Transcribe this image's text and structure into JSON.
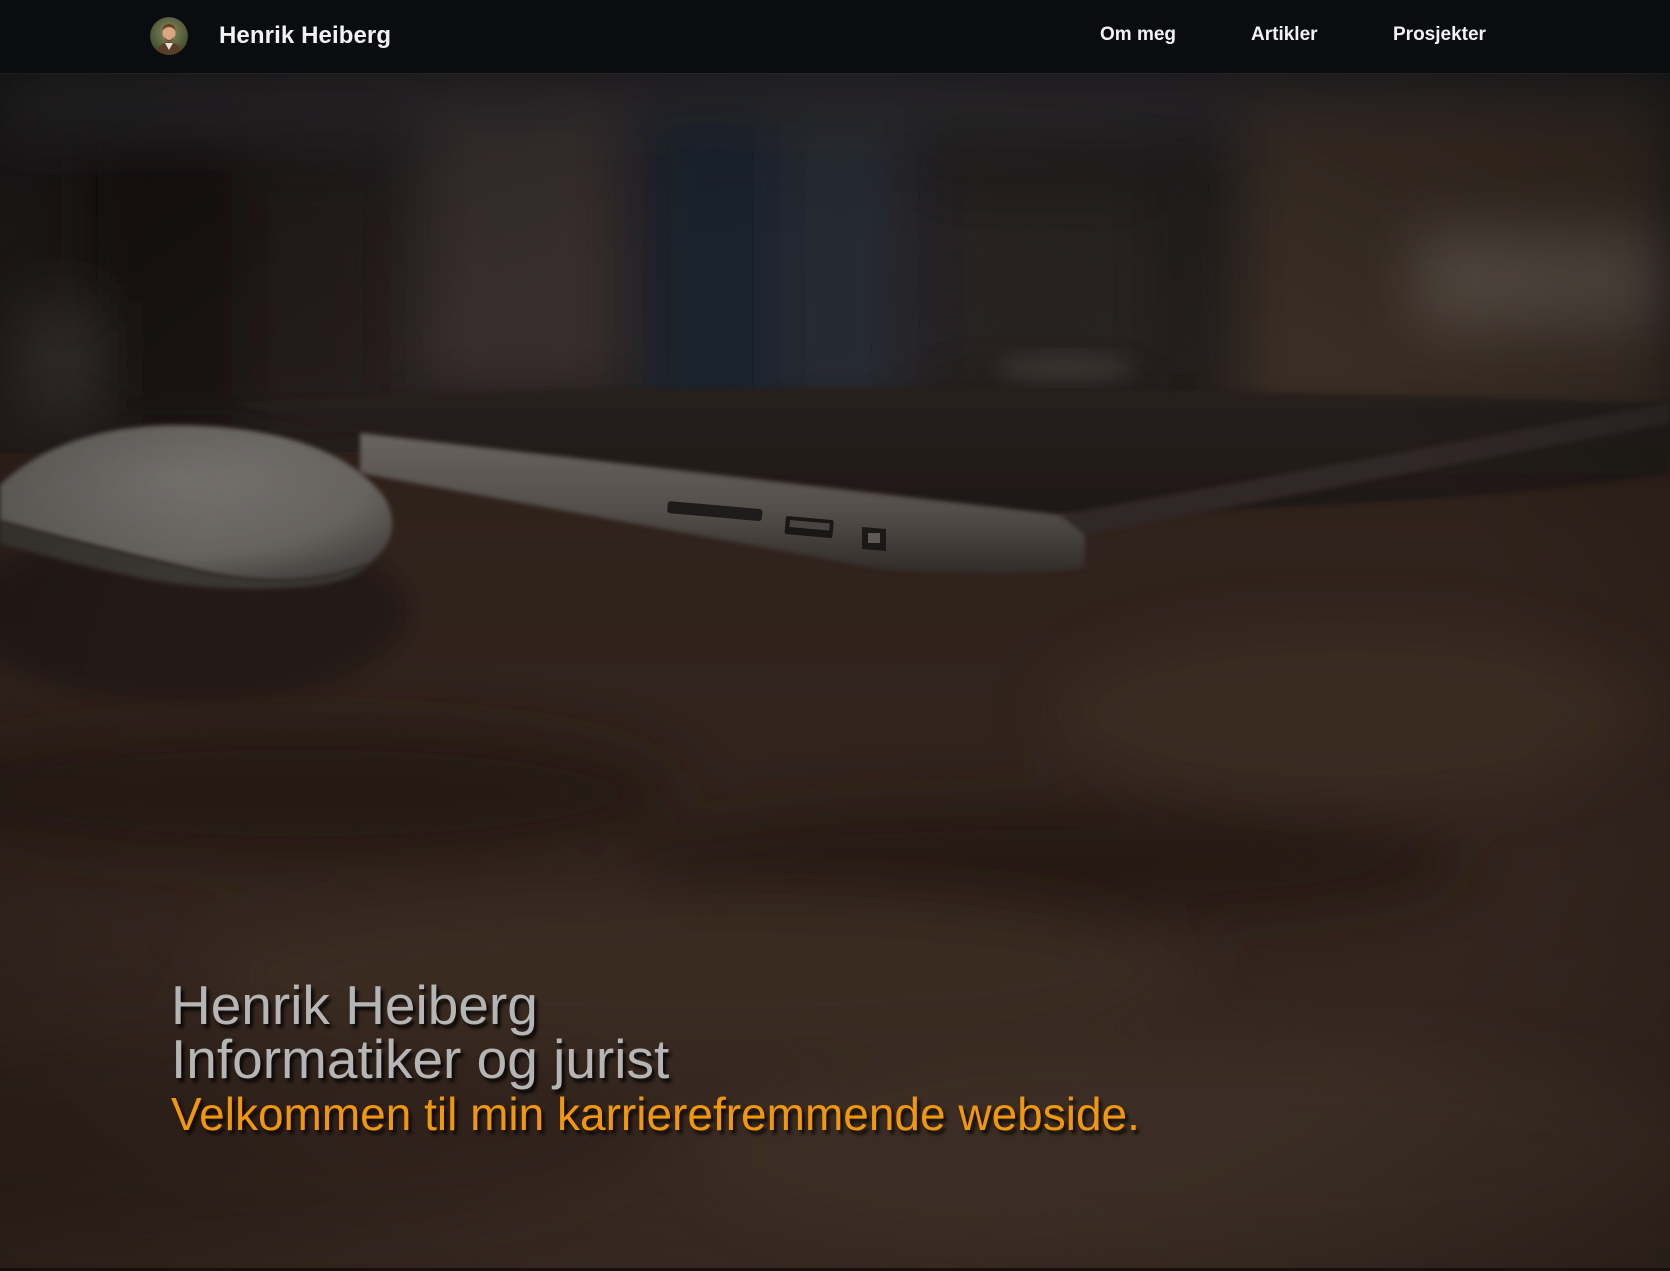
{
  "navbar": {
    "brand_name": "Henrik Heiberg",
    "avatar_icon": "profile-photo-avatar",
    "links": [
      {
        "label": "Om meg"
      },
      {
        "label": "Artikler"
      },
      {
        "label": "Prosjekter"
      }
    ],
    "background_color": "#0a0c0f",
    "text_color": "#f2f2f2"
  },
  "hero": {
    "background_image": "laptop-and-mouse-on-wooden-desk",
    "name": "Henrik Heiberg",
    "role": "Informatiker og jurist",
    "welcome": "Velkommen til min karrierefremmende webside.",
    "title_color": "#b5b5b5",
    "accent_color": "#f0960f"
  }
}
